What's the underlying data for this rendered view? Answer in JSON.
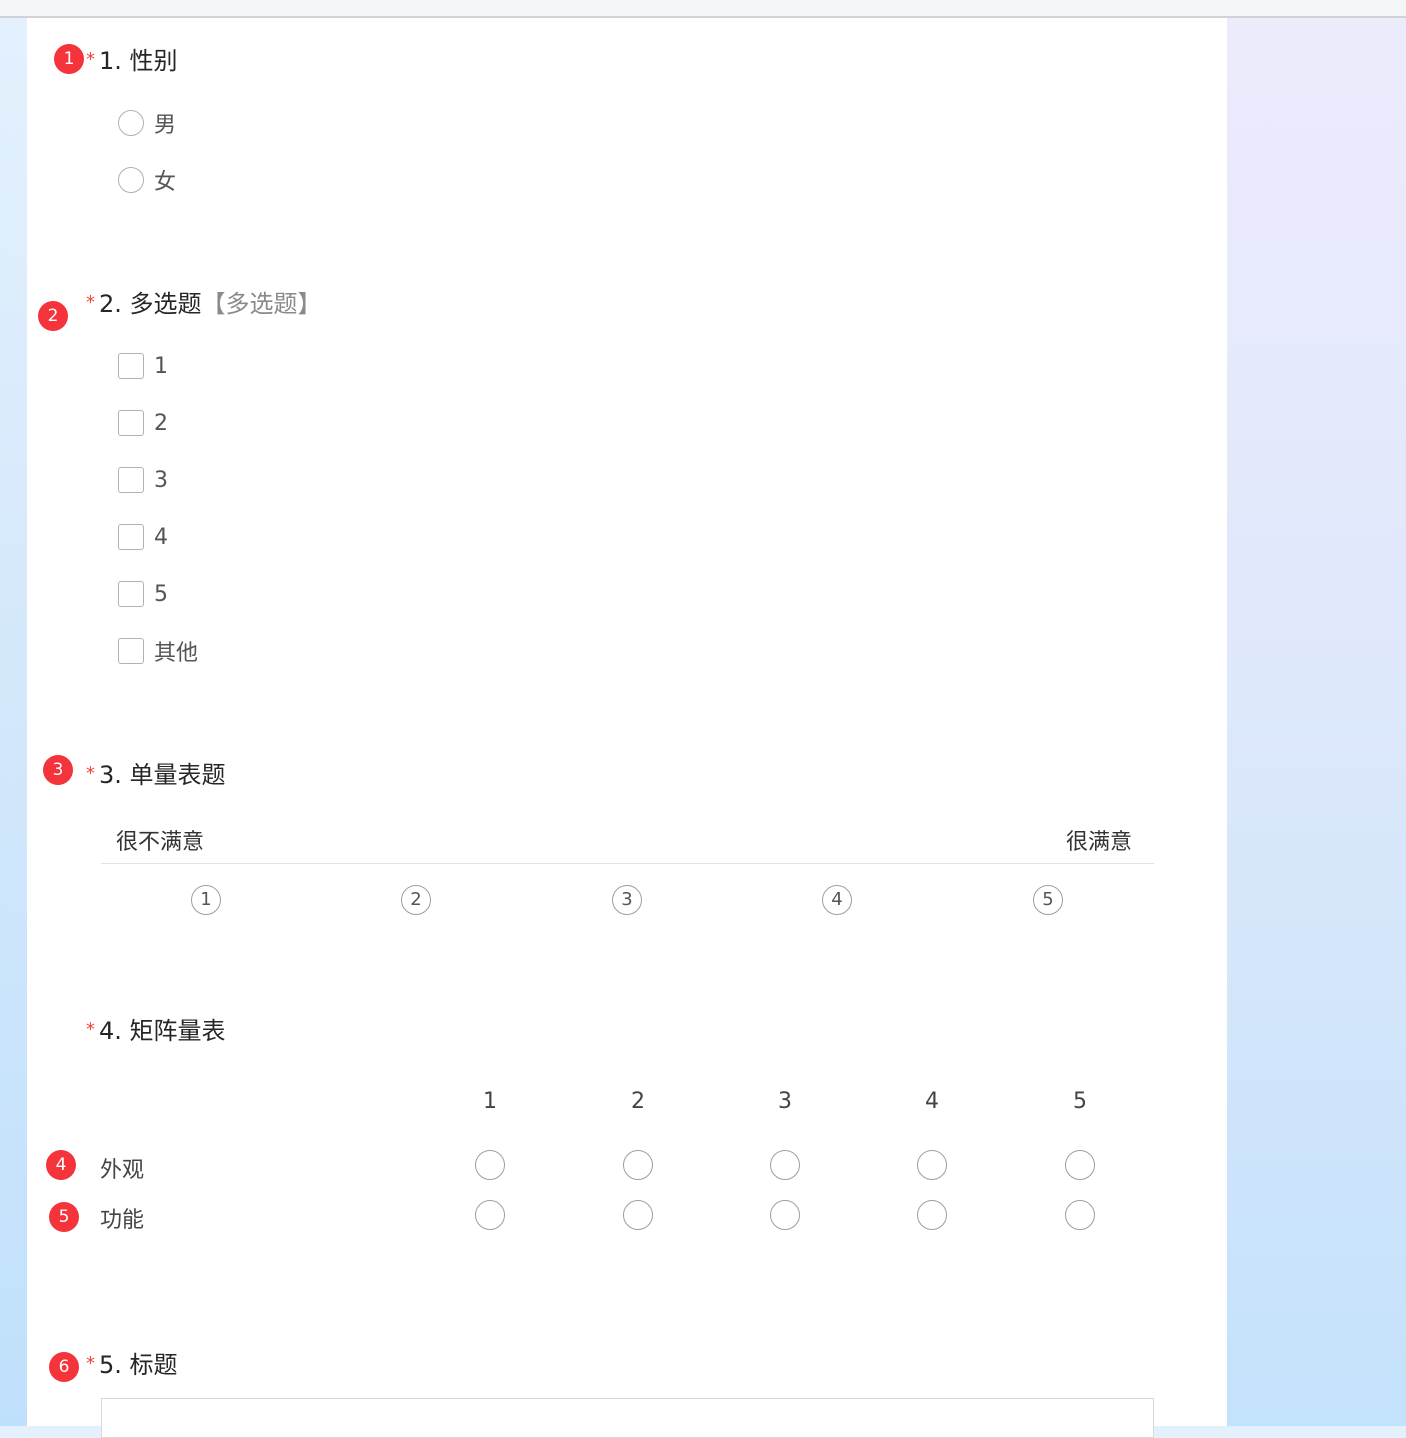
{
  "annotations": [
    "1",
    "2",
    "3",
    "4",
    "5",
    "6"
  ],
  "q1": {
    "number": "1.",
    "title": "性别",
    "required": "*",
    "options": [
      "男",
      "女"
    ]
  },
  "q2": {
    "number": "2.",
    "title": "多选题",
    "hint": "【多选题】",
    "required": "*",
    "options": [
      "1",
      "2",
      "3",
      "4",
      "5",
      "其他"
    ]
  },
  "q3": {
    "number": "3.",
    "title": "单量表题",
    "required": "*",
    "left_label": "很不满意",
    "right_label": "很满意",
    "scale": [
      "1",
      "2",
      "3",
      "4",
      "5"
    ]
  },
  "q4": {
    "number": "4.",
    "title": "矩阵量表",
    "required": "*",
    "columns": [
      "1",
      "2",
      "3",
      "4",
      "5"
    ],
    "rows": [
      "外观",
      "功能"
    ]
  },
  "q5": {
    "number": "5.",
    "title": "标题",
    "required": "*"
  },
  "colors": {
    "badge": "#f4333a",
    "required": "#f44336"
  }
}
